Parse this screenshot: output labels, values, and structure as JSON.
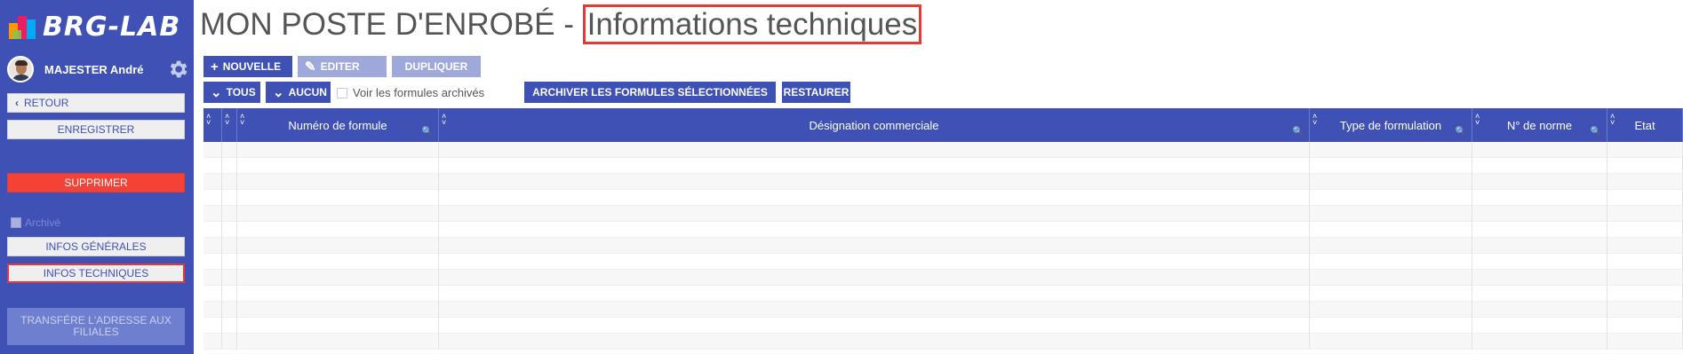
{
  "brand": {
    "logo_text": "BRG-LAB"
  },
  "user": {
    "name": "MAJESTER André"
  },
  "sidebar": {
    "retour": "RETOUR",
    "enregistrer": "ENREGISTRER",
    "supprimer": "SUPPRIMER",
    "archive_label": "Archivé",
    "infos_generales": "INFOS GÉNÉRALES",
    "infos_techniques": "INFOS TECHNIQUES",
    "transfere": "TRANSFÉRE L'ADRESSE AUX FILIALES"
  },
  "page": {
    "title_prefix": "MON POSTE D'ENROBÉ - ",
    "title_highlight": "Informations techniques"
  },
  "toolbar": {
    "nouvelle": "NOUVELLE",
    "editer": "EDITER",
    "dupliquer": "DUPLIQUER",
    "tous": "TOUS",
    "aucun": "AUCUN",
    "voir_archives": "Voir les formules archivés",
    "archiver": "ARCHIVER LES FORMULES SÉLECTIONNÉES",
    "restaurer": "RESTAURER"
  },
  "table": {
    "columns": [
      {
        "label": "",
        "searchable": false
      },
      {
        "label": "",
        "searchable": false
      },
      {
        "label": "Numéro de formule",
        "searchable": true
      },
      {
        "label": "Désignation commerciale",
        "searchable": true
      },
      {
        "label": "Type de formulation",
        "searchable": true
      },
      {
        "label": "N° de norme",
        "searchable": true
      },
      {
        "label": "Etat",
        "searchable": false
      }
    ],
    "rows": []
  },
  "colors": {
    "primary": "#3f51b5",
    "danger": "#f44336",
    "highlight": "#e53935"
  }
}
